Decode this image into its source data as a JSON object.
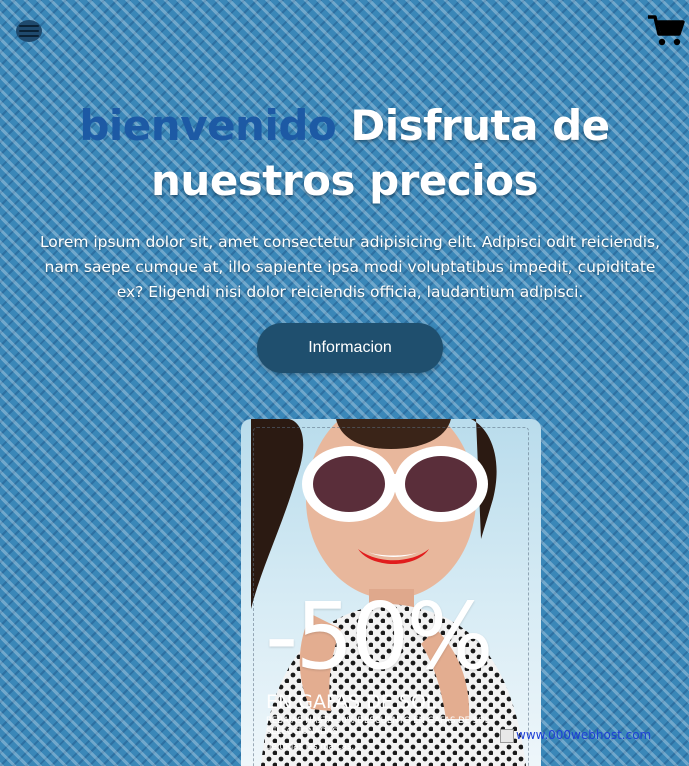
{
  "header": {
    "menu_icon": "hamburger-icon",
    "cart_icon": "shopping-cart-icon"
  },
  "hero": {
    "title_accent": "bienvenido",
    "title_line1": " Disfruta de",
    "title_line2": "nuestros precios",
    "description": "Lorem ipsum dolor sit, amet consectetur adipisicing elit. Adipisci odit reiciendis, nam saepe cumque at, illo sapiente ipsa modi voluptatibus impedit, cupiditate ex? Eligendi nisi dolor reiciendis officia, laudantium adipisci.",
    "button_label": "Informacion"
  },
  "promo": {
    "percent": "-50%",
    "headline": "EN GAFAS DE SOL",
    "subline": "REBAJAS HASTA 50% DESCUENTO EN GAFAS DE SOL SELECCIONADAS",
    "small_text": "de todas las marcas..."
  },
  "footer_link": {
    "text": "www.000webhost.com"
  },
  "colors": {
    "background": "#3a87b8",
    "accent": "#1d5aa5",
    "button": "#1f4f6e"
  }
}
